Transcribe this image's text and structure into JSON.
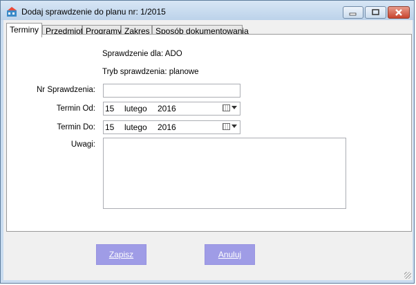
{
  "window": {
    "title": "Dodaj sprawdzenie do planu nr: 1/2015",
    "icon": "app-logo-icon",
    "controls": [
      "minimize-icon",
      "maximize-icon",
      "close-icon"
    ],
    "colors": {
      "frame": "#c9dcf0",
      "button_accent": "#9f9ce6",
      "close_button": "#c8452f"
    }
  },
  "tabs": [
    {
      "label": "Terminy",
      "active": true
    },
    {
      "label": "Przedmiot",
      "active": false
    },
    {
      "label": "Programy",
      "active": false
    },
    {
      "label": "Zakres",
      "active": false
    },
    {
      "label": "Sposób dokumentowania",
      "active": false
    }
  ],
  "form": {
    "sprawdzenie_dla": "Sprawdzenie dla: ADO",
    "tryb": "Tryb sprawdzenia: planowe",
    "nr_label": "Nr Sprawdzenia:",
    "nr_value": "",
    "termin_od_label": "Termin Od:",
    "termin_od": {
      "day": "15",
      "month": "lutego",
      "year": "2016"
    },
    "termin_do_label": "Termin Do:",
    "termin_do": {
      "day": "15",
      "month": "lutego",
      "year": "2016"
    },
    "uwagi_label": "Uwagi:",
    "uwagi_value": ""
  },
  "buttons": {
    "save": "Zapisz",
    "cancel": "Anuluj"
  }
}
